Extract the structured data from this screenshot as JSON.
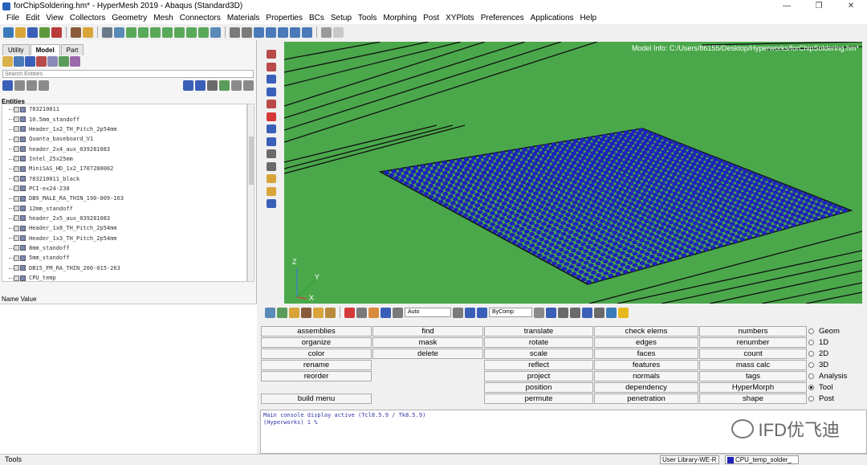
{
  "window": {
    "title": "forChipSoldering.hm* - HyperMesh 2019 - Abaqus (Standard3D)",
    "min_glyph": "—",
    "max_glyph": "❐",
    "close_glyph": "✕"
  },
  "menubar": [
    "File",
    "Edit",
    "View",
    "Collectors",
    "Geometry",
    "Mesh",
    "Connectors",
    "Materials",
    "Properties",
    "BCs",
    "Setup",
    "Tools",
    "Morphing",
    "Post",
    "XYPlots",
    "Preferences",
    "Applications",
    "Help"
  ],
  "left_panel": {
    "tabs": [
      "Utility",
      "Model",
      "Part"
    ],
    "active_tab": "Model",
    "search_placeholder": "Search Entities",
    "entities_header": "Entities",
    "tree_items": [
      "783210011",
      "10.5mm_standoff",
      "Header_1x2_TH_Pitch_2p54mm",
      "Quanta_baseboard_V1",
      "header_2x4_aux_039281083",
      "Intel_25x25mm",
      "MiniSAS_HD_1x2_1707280002",
      "783210011_black",
      "PCI-ex24-230",
      "DB9_MALE_RA_THIN_190-009-163",
      "12mm_standoff",
      "header_2x5_aux_039281083",
      "Header_1x8_TH_Pitch_2p54mm",
      "Header_1x3_TH_Pitch_2p54mm",
      "8mm_standoff",
      "5mm_standoff",
      "DB15_FM_RA_THIN_200-015-263",
      "CPU_temp"
    ],
    "name_value_header": "Name Value"
  },
  "viewport": {
    "model_info": "Model Info: C:/Users/86155/Desktop/Hyperworks/forChipSoldering.hm*",
    "axis_z": "Z",
    "axis_y": "Y",
    "axis_x": "X",
    "colors": {
      "background": "#4aa84b",
      "solder": "#1e22b8",
      "line": "#111111"
    }
  },
  "bottom_toolbar": {
    "auto_combo": "Auto",
    "bycomp_combo": "ByComp"
  },
  "menu_grid": {
    "col1": [
      "assemblies",
      "organize",
      "color",
      "rename",
      "reorder",
      "build menu"
    ],
    "col2": [
      "find",
      "mask",
      "delete"
    ],
    "col3": [
      "translate",
      "rotate",
      "scale",
      "reflect",
      "project",
      "position",
      "permute"
    ],
    "col4": [
      "check elems",
      "edges",
      "faces",
      "features",
      "normals",
      "dependency",
      "penetration"
    ],
    "col5": [
      "numbers",
      "renumber",
      "count",
      "mass calc",
      "tags",
      "HyperMorph",
      "shape"
    ],
    "radios": [
      "Geom",
      "1D",
      "2D",
      "3D",
      "Analysis",
      "Tool",
      "Post"
    ],
    "radio_selected": "Tool"
  },
  "console": {
    "line1": "Main console display active (Tcl8.5.9 / Tk8.5.9)",
    "line2": "(Hyperworks) 1 %"
  },
  "watermark": "IFD优飞迪",
  "statusbar": {
    "left": "Tools",
    "library": "User Library-WE-R",
    "component": "CPU_temp_solder_"
  }
}
